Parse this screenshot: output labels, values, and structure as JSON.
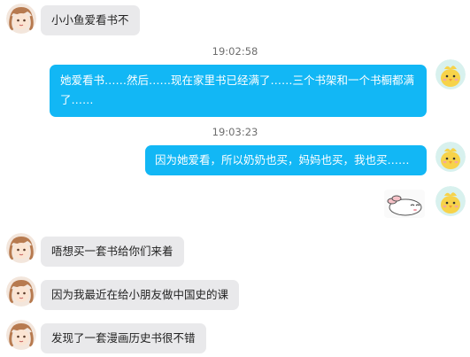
{
  "messages": {
    "m1": "小小鱼爱看书不",
    "m2": "她爱看书……然后……现在家里书已经满了……三个书架和一个书橱都满了……",
    "m3": "因为她爱看，所以奶奶也买，妈妈也买，我也买……",
    "m4": "唔想买一套书给你们来着",
    "m5": "因为我最近在给小朋友做中国史的课",
    "m6": "发现了一套漫画历史书很不错"
  },
  "timestamps": {
    "t1": "19:02:58",
    "t2": "19:03:23"
  },
  "colors": {
    "outgoing_bubble": "#12b7f5",
    "incoming_bubble": "#e9e9eb"
  },
  "icons": {
    "sender_avatar": "girl-avatar-icon",
    "self_avatar": "yellow-chick-avatar-icon",
    "sticker": "bunny-sticker-icon"
  }
}
